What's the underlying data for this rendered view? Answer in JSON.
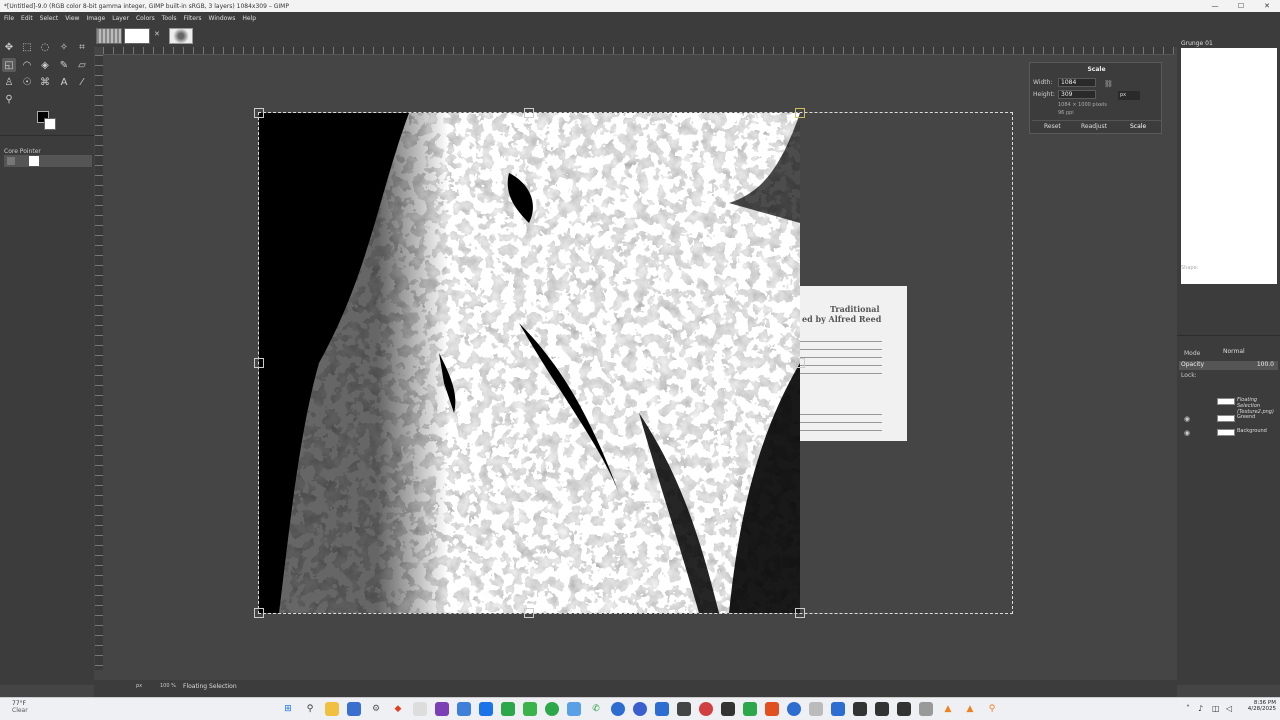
{
  "window": {
    "title": "*[Untitled]-9.0 (RGB color 8-bit gamma integer, GIMP built-in sRGB, 3 layers) 1084x309 – GIMP",
    "minimize": "—",
    "maximize": "☐",
    "close": "✕"
  },
  "menubar": [
    "File",
    "Edit",
    "Select",
    "View",
    "Image",
    "Layer",
    "Colors",
    "Tools",
    "Filters",
    "Windows",
    "Help"
  ],
  "tool_options": {
    "title": "Core Pointer"
  },
  "image_tabs": {
    "close": "✕"
  },
  "canvas": {
    "sheet_title_1": "Traditional",
    "sheet_title_2": "ed by Alfred Reed"
  },
  "scale_dialog": {
    "title": "Scale",
    "width_label": "Width:",
    "width_value": "1084",
    "height_label": "Height:",
    "height_value": "309",
    "size_info": "1084 × 1000 pixels",
    "ppi_info": "96 ppi",
    "unit": "px",
    "reset_label": "Reset",
    "readjust_label": "Readjust",
    "scale_label": "Scale"
  },
  "dock": {
    "brush_name": "Grunge 01",
    "shape_label": "Shape:",
    "mode_label": "Mode",
    "mode_value": "Normal",
    "opacity_label": "Opacity",
    "opacity_value": "100.0",
    "lock_label": "Lock:",
    "layers": [
      {
        "name": "Floating Selection (Texture2.png)",
        "visible": false
      },
      {
        "name": "Greend",
        "visible": true
      },
      {
        "name": "Background",
        "visible": true
      }
    ]
  },
  "statusbar": {
    "unit": "px",
    "zoom": "100 %",
    "message": "Floating Selection"
  },
  "taskbar": {
    "weather_temp": "77°F",
    "weather_cond": "Clear",
    "time": "8:36 PM",
    "date": "4/28/2025"
  }
}
